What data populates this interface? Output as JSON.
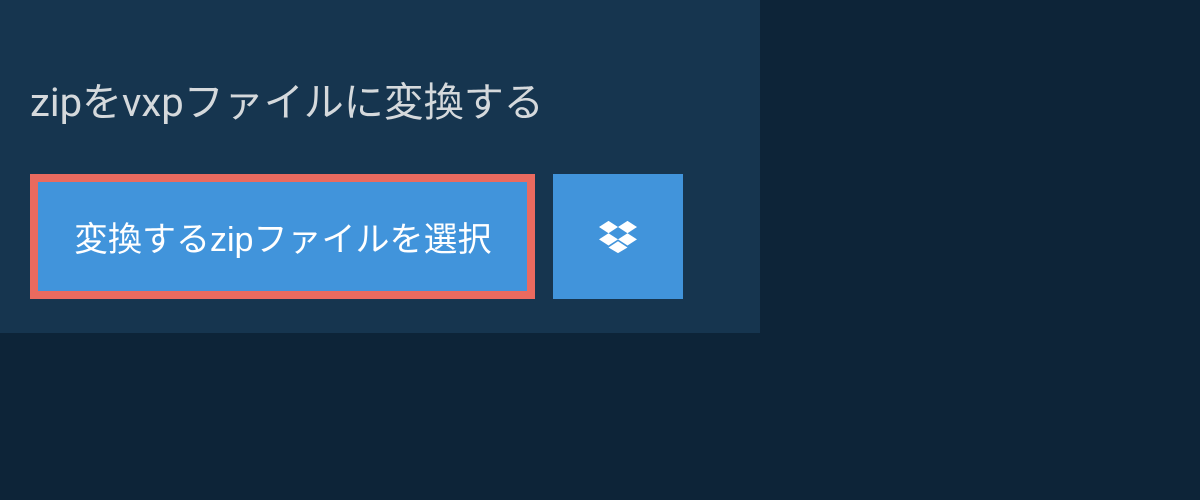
{
  "header": {
    "title": "zipをvxpファイルに変換する"
  },
  "actions": {
    "select_file_label": "変換するzipファイルを選択",
    "dropbox_icon_name": "dropbox-icon"
  },
  "colors": {
    "background": "#0d2438",
    "panel": "#16354f",
    "button_primary": "#4194db",
    "button_border_highlight": "#ea6a5f",
    "text_light": "#d5d9dc"
  }
}
